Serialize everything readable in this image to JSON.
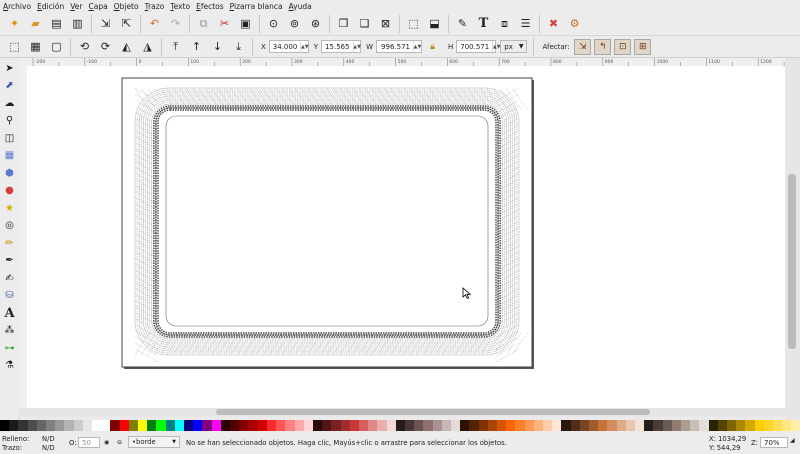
{
  "menu": [
    "Archivo",
    "Edición",
    "Ver",
    "Capa",
    "Objeto",
    "Trazo",
    "Texto",
    "Efectos",
    "Pizarra blanca",
    "Ayuda"
  ],
  "toolbar_icons": [
    "new-document-icon",
    "open-icon",
    "save-icon",
    "print-icon",
    "import-icon",
    "export-icon",
    "undo-icon",
    "redo-icon",
    "copy-icon",
    "cut-icon",
    "paste-icon",
    "zoom-selection-icon",
    "zoom-drawing-icon",
    "zoom-page-icon",
    "duplicate-icon",
    "clone-icon",
    "unlink-clone-icon",
    "group-icon",
    "ungroup-icon",
    "fill-stroke-icon",
    "text-icon",
    "xml-editor-icon",
    "align-icon",
    "preferences-icon",
    "document-properties-icon"
  ],
  "controls": {
    "x_label": "X",
    "x_value": "34.000",
    "y_label": "Y",
    "y_value": "15.565",
    "w_label": "W",
    "w_value": "996.571",
    "h_label": "H",
    "h_value": "700.571",
    "unit": "px",
    "affect_label": "Afectar:"
  },
  "ruler_labels": [
    "-200",
    "-100",
    "0",
    "100",
    "200",
    "300",
    "400",
    "500",
    "600",
    "700",
    "800",
    "900",
    "1000",
    "1100",
    "1200"
  ],
  "status": {
    "fill_label": "Relleno:",
    "fill_value": "N/D",
    "stroke_label": "Trazo:",
    "stroke_value": "N/D",
    "opacity_label": "O:",
    "opacity_value": "50",
    "layer": "•borde",
    "message": "No se han seleccionado objetos. Haga clic, Mayús+clic o arrastre para seleccionar los objetos.",
    "coord_x": "X: 1034,29",
    "coord_y": "Y:   544,29",
    "zoom_label": "Z:",
    "zoom_value": "70%"
  },
  "colors": {
    "accent": "#e0d6c8",
    "canvas": "#ffffff"
  }
}
